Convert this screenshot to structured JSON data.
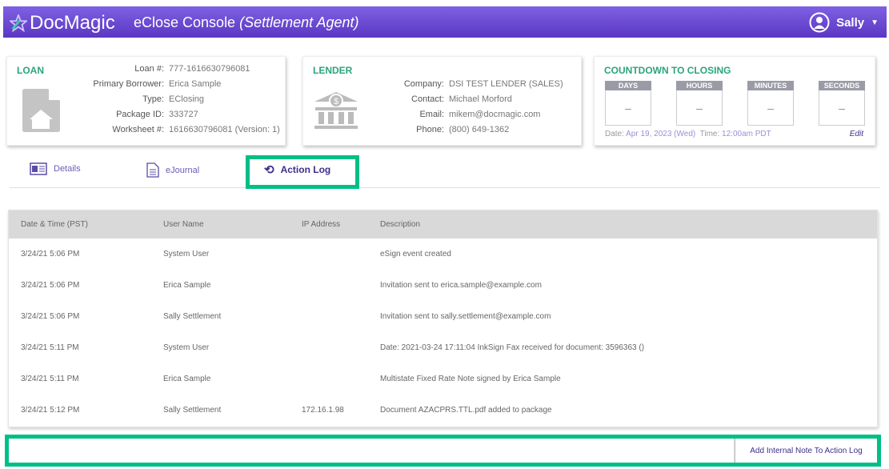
{
  "header": {
    "logo": "DocMagic",
    "title": "eClose Console",
    "role": "(Settlement Agent)",
    "user": "Sally"
  },
  "loan": {
    "title": "LOAN",
    "fields": [
      [
        "Loan #:",
        "777-1616630796081"
      ],
      [
        "Primary Borrower:",
        "Erica Sample"
      ],
      [
        "Type:",
        "EClosing"
      ],
      [
        "Package ID:",
        "333727"
      ],
      [
        "Worksheet #:",
        "1616630796081 (Version: 1)"
      ]
    ]
  },
  "lender": {
    "title": "LENDER",
    "fields": [
      [
        "Company:",
        "DSI TEST LENDER (SALES)"
      ],
      [
        "Contact:",
        "Michael Morford"
      ],
      [
        "Email:",
        "mikem@docmagic.com"
      ],
      [
        "Phone:",
        "(800) 649-1362"
      ]
    ]
  },
  "countdown": {
    "title": "COUNTDOWN TO CLOSING",
    "units": [
      [
        "DAYS",
        "–"
      ],
      [
        "HOURS",
        "–"
      ],
      [
        "MINUTES",
        "–"
      ],
      [
        "SECONDS",
        "–"
      ]
    ],
    "date_label": "Date:",
    "date": "Apr 19, 2023 (Wed)",
    "time_label": "Time:",
    "time": "12:00am PDT",
    "edit": "Edit"
  },
  "tabs": {
    "details": "Details",
    "ejournal": "eJournal",
    "action_log": "Action Log"
  },
  "table": {
    "headers": [
      "Date & Time (PST)",
      "User Name",
      "IP Address",
      "Description"
    ],
    "rows": [
      [
        "3/24/21 5:06 PM",
        "System User",
        "",
        "eSign event created"
      ],
      [
        "3/24/21 5:06 PM",
        "Erica Sample",
        "",
        "Invitation sent to erica.sample@example.com"
      ],
      [
        "3/24/21 5:06 PM",
        "Sally Settlement",
        "",
        "Invitation sent to sally.settlement@example.com"
      ],
      [
        "3/24/21 5:11 PM",
        "System User",
        "",
        "Date: 2021-03-24 17:11:04 InkSign Fax received for document: 3596363 ()"
      ],
      [
        "3/24/21 5:11 PM",
        "Erica Sample",
        "",
        "Multistate Fixed Rate Note signed by Erica Sample"
      ],
      [
        "3/24/21 5:12 PM",
        "Sally Settlement",
        "172.16.1.98",
        "Document AZACPRS.TTL.pdf added to package"
      ]
    ]
  },
  "note": {
    "placeholder": "",
    "button": "Add Internal Note To Action Log"
  }
}
